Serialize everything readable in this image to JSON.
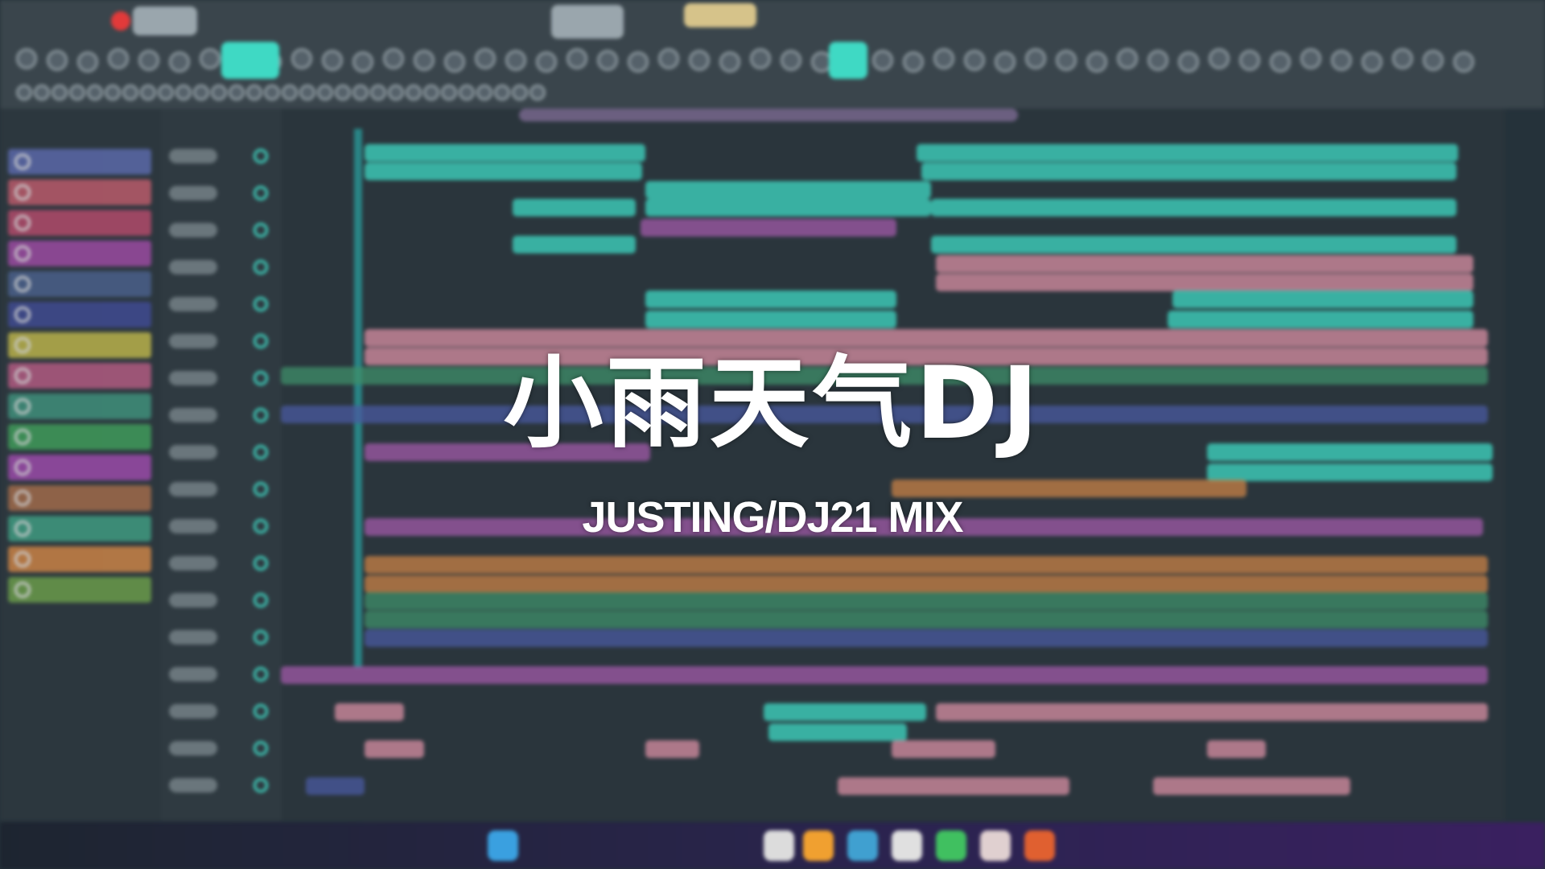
{
  "overlay": {
    "title": "小雨天气DJ",
    "subtitle": "JUSTING/DJ21 MIX"
  },
  "app": "FL Studio playlist (blurred)",
  "colors": {
    "teal": "#3fd9c4",
    "pink": "#d98fa3",
    "purple": "#a25aa8",
    "green": "#3f8f6a",
    "blue": "#4a5aa0",
    "orange": "#c98246",
    "yellow": "#b8b04a",
    "record": "#e23a3a"
  },
  "patterns": [
    "#5a68a8",
    "#b85a6a",
    "#b04a6a",
    "#9a4aa0",
    "#4a5f8a",
    "#3f4a90",
    "#b8b04a",
    "#b05a80",
    "#3f8f7a",
    "#3f9a5a",
    "#9a4aa8",
    "#a06a4a",
    "#3f9a80",
    "#c98246",
    "#6a9a4a"
  ]
}
